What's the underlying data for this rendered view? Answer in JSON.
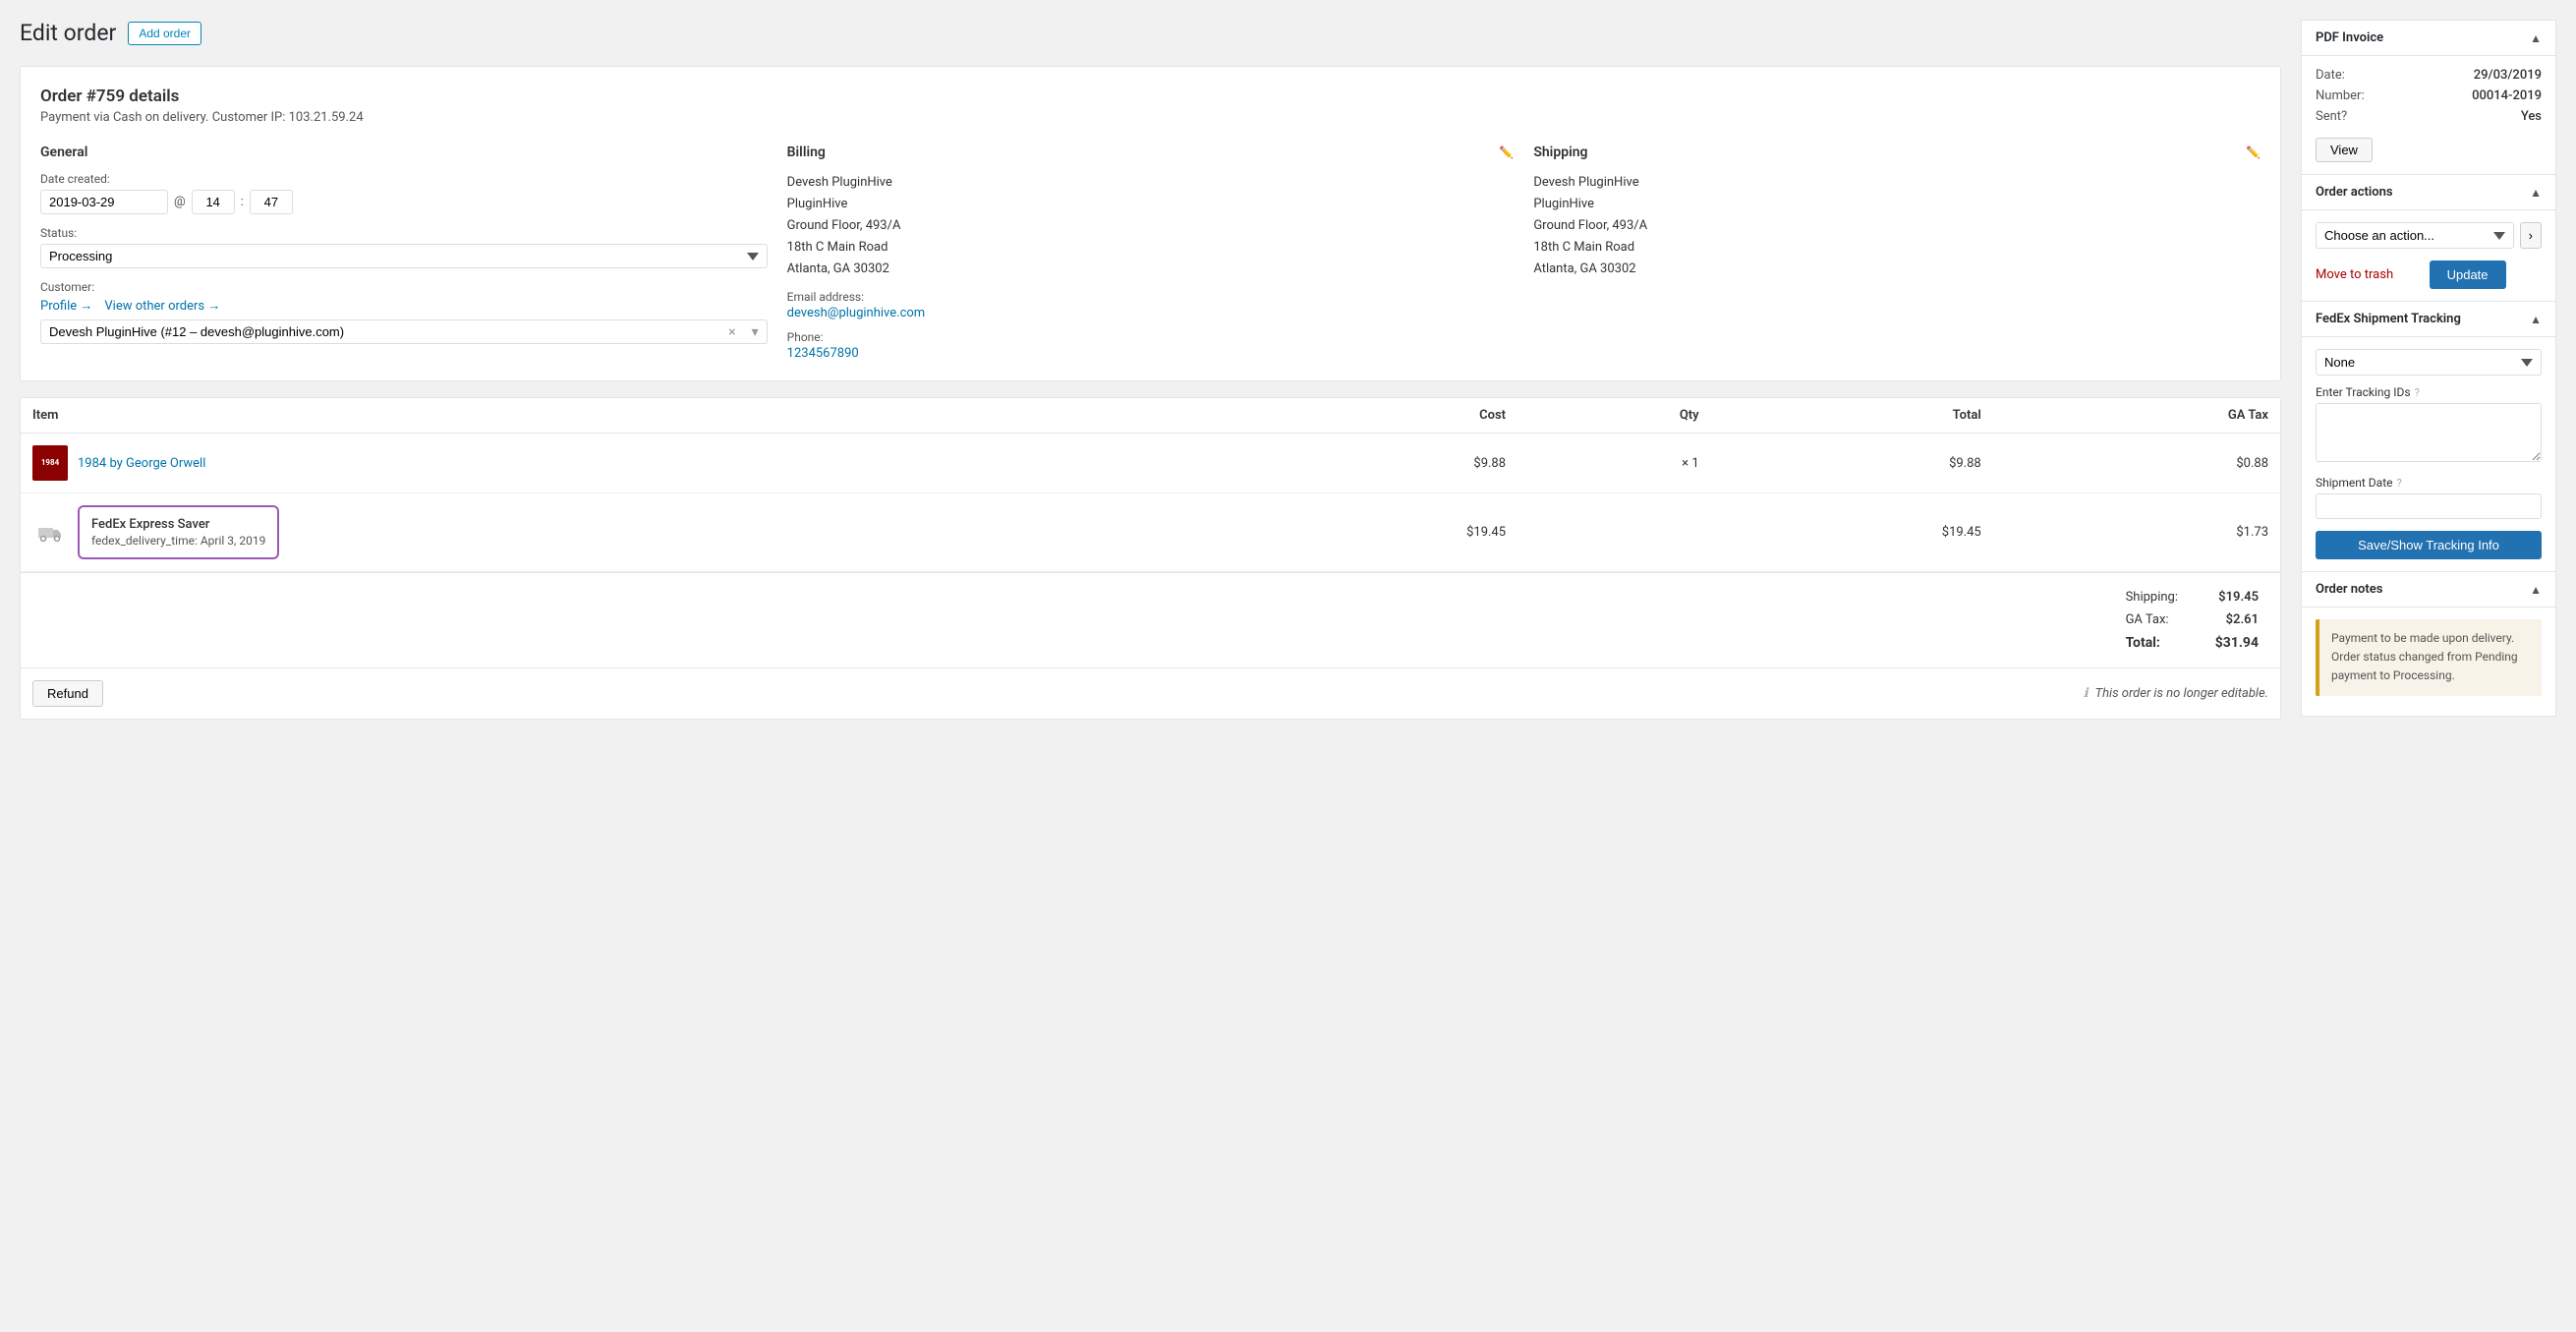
{
  "page": {
    "title": "Edit order",
    "add_order_btn": "Add order"
  },
  "order": {
    "title": "Order #759 details",
    "subtitle": "Payment via Cash on delivery. Customer IP: 103.21.59.24",
    "general": {
      "section_title": "General",
      "date_label": "Date created:",
      "date_value": "2019-03-29",
      "time_hour": "14",
      "time_min": "47",
      "at": "@",
      "status_label": "Status:",
      "status_value": "Processing",
      "customer_label": "Customer:",
      "profile_link": "Profile →",
      "view_orders_link": "View other orders →",
      "customer_value": "Devesh PluginHive (#12 – devesh@pluginhive.com)"
    },
    "billing": {
      "section_title": "Billing",
      "name": "Devesh PluginHive",
      "company": "PluginHive",
      "address1": "Ground Floor, 493/A",
      "address2": "18th C Main Road",
      "city_state": "Atlanta, GA 30302",
      "email_label": "Email address:",
      "email": "devesh@pluginhive.com",
      "phone_label": "Phone:",
      "phone": "1234567890"
    },
    "shipping": {
      "section_title": "Shipping",
      "name": "Devesh PluginHive",
      "company": "PluginHive",
      "address1": "Ground Floor, 493/A",
      "address2": "18th C Main Road",
      "city_state": "Atlanta, GA 30302"
    }
  },
  "items": {
    "columns": {
      "item": "Item",
      "cost": "Cost",
      "qty": "Qty",
      "total": "Total",
      "ga_tax": "GA Tax"
    },
    "products": [
      {
        "name": "1984 by George Orwell",
        "thumb_text": "1984",
        "cost": "$9.88",
        "qty": "× 1",
        "total": "$9.88",
        "ga_tax": "$0.88"
      }
    ],
    "shipping_item": {
      "name": "FedEx Express Saver",
      "meta_key": "fedex_delivery_time:",
      "meta_value": "April 3, 2019",
      "cost": "$19.45",
      "ga_tax": "$1.73"
    },
    "totals": {
      "shipping_label": "Shipping:",
      "shipping_value": "$19.45",
      "ga_tax_label": "GA Tax:",
      "ga_tax_value": "$2.61",
      "total_label": "Total:",
      "total_value": "$31.94"
    },
    "refund_btn": "Refund",
    "not_editable": "This order is no longer editable."
  },
  "right_panel": {
    "pdf_invoice": {
      "title": "PDF Invoice",
      "date_label": "Date:",
      "date_value": "29/03/2019",
      "number_label": "Number:",
      "number_value": "00014-2019",
      "sent_label": "Sent?",
      "sent_value": "Yes",
      "view_btn": "View"
    },
    "order_actions": {
      "title": "Order actions",
      "select_placeholder": "Choose an action...",
      "move_to_trash": "Move to trash",
      "update_btn": "Update"
    },
    "fedex_tracking": {
      "title": "FedEx Shipment Tracking",
      "select_value": "None",
      "tracking_ids_label": "Enter Tracking IDs",
      "shipment_date_label": "Shipment Date",
      "save_btn": "Save/Show Tracking Info"
    },
    "order_notes": {
      "title": "Order notes",
      "note": "Payment to be made upon delivery. Order status changed from Pending payment to Processing."
    }
  }
}
